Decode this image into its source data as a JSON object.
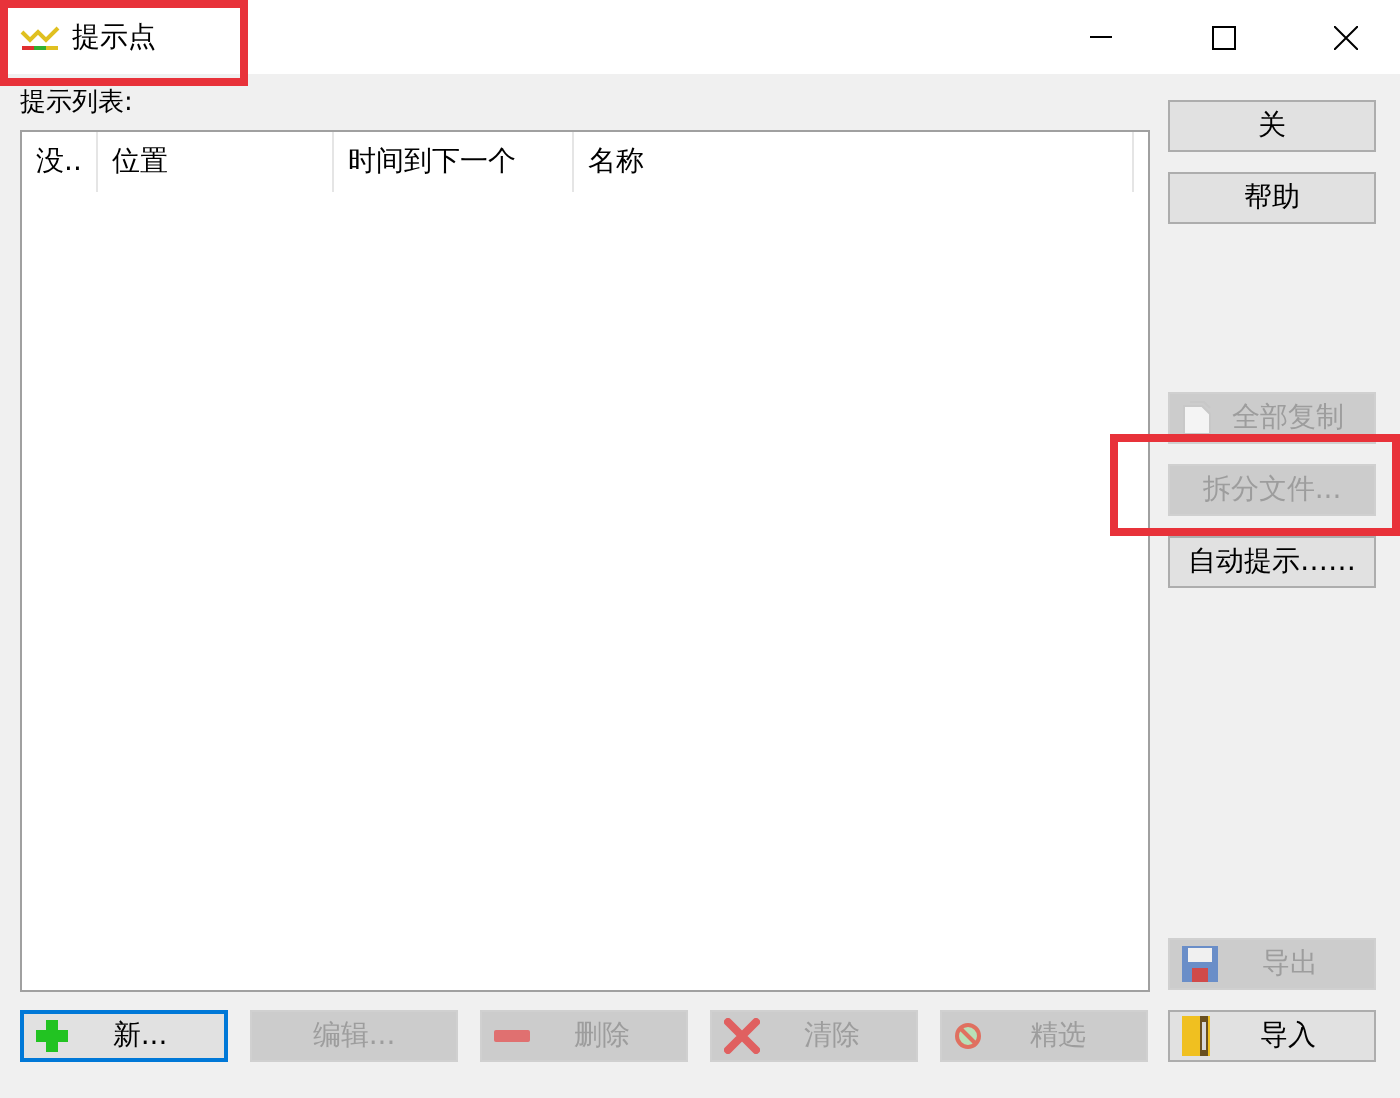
{
  "window": {
    "title": "提示点"
  },
  "list": {
    "label": "提示列表:",
    "columns": [
      {
        "label": "没.."
      },
      {
        "label": "位置"
      },
      {
        "label": "时间到下一个"
      },
      {
        "label": "名称"
      }
    ]
  },
  "side_buttons_top": [
    {
      "label": "关",
      "disabled": false
    },
    {
      "label": "帮助",
      "disabled": false
    }
  ],
  "side_buttons_middle": [
    {
      "label": "全部复制",
      "disabled": true,
      "kind": "copy"
    },
    {
      "label": "拆分文件...",
      "disabled": true,
      "kind": "plain"
    },
    {
      "label": "自动提示……",
      "disabled": false,
      "kind": "plain"
    }
  ],
  "export_button": {
    "label": "导出",
    "disabled": true,
    "kind": "disk"
  },
  "bottom_buttons": [
    {
      "label": "新...",
      "disabled": false,
      "focused": true,
      "kind": "plus"
    },
    {
      "label": "编辑...",
      "disabled": true,
      "focused": false,
      "kind": "plain"
    },
    {
      "label": "删除",
      "disabled": true,
      "focused": false,
      "kind": "minus"
    },
    {
      "label": "清除",
      "disabled": true,
      "focused": false,
      "kind": "cross"
    },
    {
      "label": "精选",
      "disabled": true,
      "focused": false,
      "kind": "no"
    },
    {
      "label": "导入",
      "disabled": false,
      "focused": false,
      "kind": "book"
    }
  ]
}
